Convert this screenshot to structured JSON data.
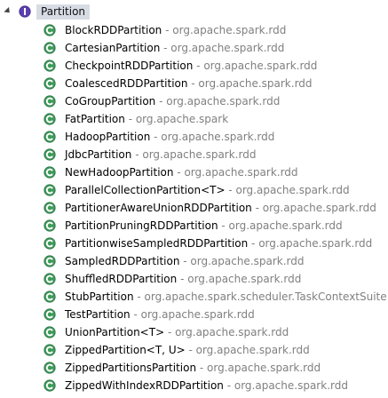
{
  "colors": {
    "class_icon": "#3e9a5a",
    "interface_icon": "#5b3fb0",
    "package_text": "#808080",
    "root_highlight": "#d7dce4"
  },
  "root": {
    "icon": "interface-icon",
    "label": "Partition",
    "toggle_icon": "expanded-triangle-icon"
  },
  "items": [
    {
      "name": "BlockRDDPartition",
      "package": " - org.apache.spark.rdd",
      "icon": "class-icon"
    },
    {
      "name": "CartesianPartition",
      "package": " - org.apache.spark.rdd",
      "icon": "class-icon"
    },
    {
      "name": "CheckpointRDDPartition",
      "package": " - org.apache.spark.rdd",
      "icon": "class-icon"
    },
    {
      "name": "CoalescedRDDPartition",
      "package": " - org.apache.spark.rdd",
      "icon": "class-icon"
    },
    {
      "name": "CoGroupPartition",
      "package": " - org.apache.spark.rdd",
      "icon": "class-icon"
    },
    {
      "name": "FatPartition",
      "package": " - org.apache.spark",
      "icon": "class-icon"
    },
    {
      "name": "HadoopPartition",
      "package": " - org.apache.spark.rdd",
      "icon": "class-icon"
    },
    {
      "name": "JdbcPartition",
      "package": " - org.apache.spark.rdd",
      "icon": "class-icon"
    },
    {
      "name": "NewHadoopPartition",
      "package": " - org.apache.spark.rdd",
      "icon": "class-icon"
    },
    {
      "name": "ParallelCollectionPartition<T>",
      "package": " - org.apache.spark.rdd",
      "icon": "class-icon"
    },
    {
      "name": "PartitionerAwareUnionRDDPartition",
      "package": " - org.apache.spark.rdd",
      "icon": "class-icon"
    },
    {
      "name": "PartitionPruningRDDPartition",
      "package": " - org.apache.spark.rdd",
      "icon": "class-icon"
    },
    {
      "name": "PartitionwiseSampledRDDPartition",
      "package": " - org.apache.spark.rdd",
      "icon": "class-icon"
    },
    {
      "name": "SampledRDDPartition",
      "package": " - org.apache.spark.rdd",
      "icon": "class-icon"
    },
    {
      "name": "ShuffledRDDPartition",
      "package": " - org.apache.spark.rdd",
      "icon": "class-icon"
    },
    {
      "name": "StubPartition",
      "package": " - org.apache.spark.scheduler.TaskContextSuite",
      "icon": "class-icon"
    },
    {
      "name": "TestPartition",
      "package": " - org.apache.spark.rdd",
      "icon": "class-icon"
    },
    {
      "name": "UnionPartition<T>",
      "package": " - org.apache.spark.rdd",
      "icon": "class-icon"
    },
    {
      "name": "ZippedPartition<T, U>",
      "package": " - org.apache.spark.rdd",
      "icon": "class-icon"
    },
    {
      "name": "ZippedPartitionsPartition",
      "package": " - org.apache.spark.rdd",
      "icon": "class-icon"
    },
    {
      "name": "ZippedWithIndexRDDPartition",
      "package": " - org.apache.spark.rdd",
      "icon": "class-icon"
    }
  ]
}
